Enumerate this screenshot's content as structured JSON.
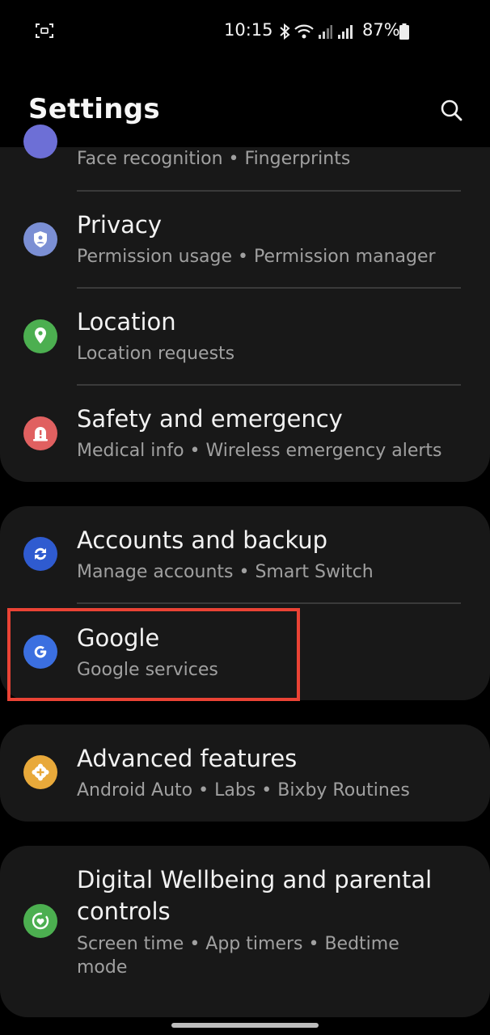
{
  "status_bar": {
    "time": "10:15",
    "battery": "87%"
  },
  "header": {
    "title": "Settings"
  },
  "colors": {
    "background": "#000000",
    "card": "#181818",
    "highlight": "#ea4335",
    "privacy": "#7b8fd4",
    "location": "#4caf50",
    "safety": "#e06060",
    "accounts": "#2f5bd0",
    "google": "#3b6fe0",
    "advanced": "#e8a93a",
    "wellbeing": "#4caf50"
  },
  "items": {
    "biometrics": {
      "subtitle": "Face recognition  •  Fingerprints"
    },
    "privacy": {
      "label": "Privacy",
      "subtitle": "Permission usage  •  Permission manager",
      "icon": "shield-icon"
    },
    "location": {
      "label": "Location",
      "subtitle": "Location requests",
      "icon": "location-pin-icon"
    },
    "safety": {
      "label": "Safety and emergency",
      "subtitle": "Medical info  •  Wireless emergency alerts",
      "icon": "alert-icon"
    },
    "accounts": {
      "label": "Accounts and backup",
      "subtitle": "Manage accounts  •  Smart Switch",
      "icon": "sync-icon"
    },
    "google": {
      "label": "Google",
      "subtitle": "Google services",
      "icon": "google-g-icon"
    },
    "advanced": {
      "label": "Advanced features",
      "subtitle": "Android Auto  •  Labs  •  Bixby Routines",
      "icon": "plus-cog-icon"
    },
    "wellbeing": {
      "label_line1": "Digital Wellbeing and parental",
      "label_line2": "controls",
      "subtitle_line1": "Screen time  •  App timers  •  Bedtime",
      "subtitle_line2": "mode",
      "icon": "wellbeing-icon"
    }
  }
}
